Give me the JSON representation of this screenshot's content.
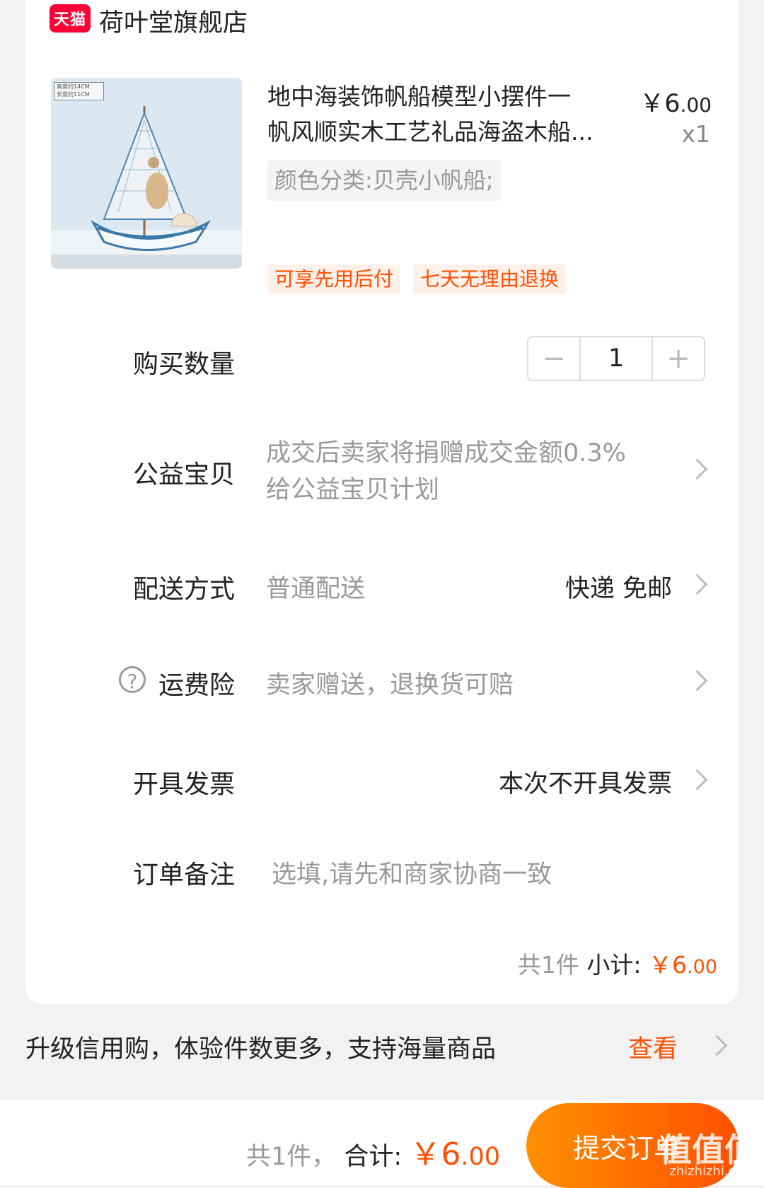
{
  "shop": {
    "badge": "天猫",
    "name": "荷叶堂旗舰店"
  },
  "product": {
    "image_label_lines": [
      "高度约14CM",
      "长度约11CM"
    ],
    "title_line1": "地中海装饰帆船模型小摆件一",
    "title_line2": "帆风顺实木工艺礼品海盗木船...",
    "price_symbol": "￥",
    "price_int": "6",
    "price_dec": ".00",
    "quantity_label": "x1",
    "spec": "颜色分类:贝壳小帆船;",
    "tags": [
      "可享先用后付",
      "七天无理由退换"
    ]
  },
  "purchase_qty": {
    "label": "购买数量",
    "minus": "−",
    "value": "1",
    "plus": "+"
  },
  "charity": {
    "label": "公益宝贝",
    "line1": "成交后卖家将捐赠成交金额0.3%",
    "line2": "给公益宝贝计划"
  },
  "delivery": {
    "label": "配送方式",
    "value": "普通配送",
    "right": "快递 免邮"
  },
  "insurance": {
    "icon": "?",
    "label": "运费险",
    "value": "卖家赠送，退换货可赔"
  },
  "invoice": {
    "label": "开具发票",
    "right": "本次不开具发票"
  },
  "note": {
    "label": "订单备注",
    "placeholder": "选填,请先和商家协商一致"
  },
  "subtotal": {
    "count": "共1件",
    "label": "小计:",
    "symbol": "￥",
    "int": "6",
    "dec": ".00"
  },
  "credit": {
    "text": "升级信用购，体验件数更多，支持海量商品",
    "link": "查看"
  },
  "footer": {
    "count": "共1件，",
    "label": "合计:",
    "symbol": "￥",
    "int": "6",
    "dec": ".00",
    "submit": "提交订单",
    "watermark": "值值值",
    "watermark_sub": "zhizhizhi.com"
  },
  "colors": {
    "accent": "#ff5000",
    "tmall": "#ff0036",
    "text": "#222222",
    "muted": "#999999"
  }
}
